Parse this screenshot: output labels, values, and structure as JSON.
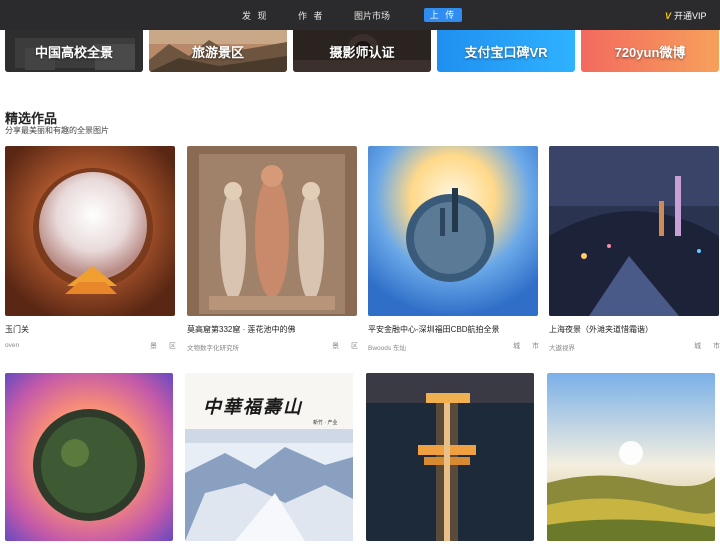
{
  "nav": {
    "discover": "发 现",
    "authors": "作 者",
    "market": "图片市场",
    "upload": "上 传",
    "vip": "开通VIP",
    "vip_mark": "V"
  },
  "banners": [
    "中国高校全景",
    "旅游景区",
    "摄影师认证",
    "支付宝口碑VR",
    "720yun微博"
  ],
  "section": {
    "title": "精选作品",
    "subtitle": "分享最美丽和有趣的全景图片"
  },
  "works": [
    {
      "title": "玉门关",
      "author": "oven",
      "tag": "景 区"
    },
    {
      "title": "莫高窟第332窟 · 莲花池中的佛",
      "author": "文物数字化研究所",
      "tag": "景 区"
    },
    {
      "title": "平安金融中心-深圳福田CBD航拍全景",
      "author": "Bwoods 东灿",
      "tag": "城 市"
    },
    {
      "title": "上海夜景（外滩夹道惜霜谐）",
      "author": "大遨视界",
      "tag": "城 市"
    }
  ],
  "poster_text": {
    "main": "中華福壽山",
    "side": "新竹 · 产业"
  },
  "colors": {
    "topbar": "#2b2b2d",
    "accent": "#2f8cf1",
    "vip": "#f5c518"
  }
}
